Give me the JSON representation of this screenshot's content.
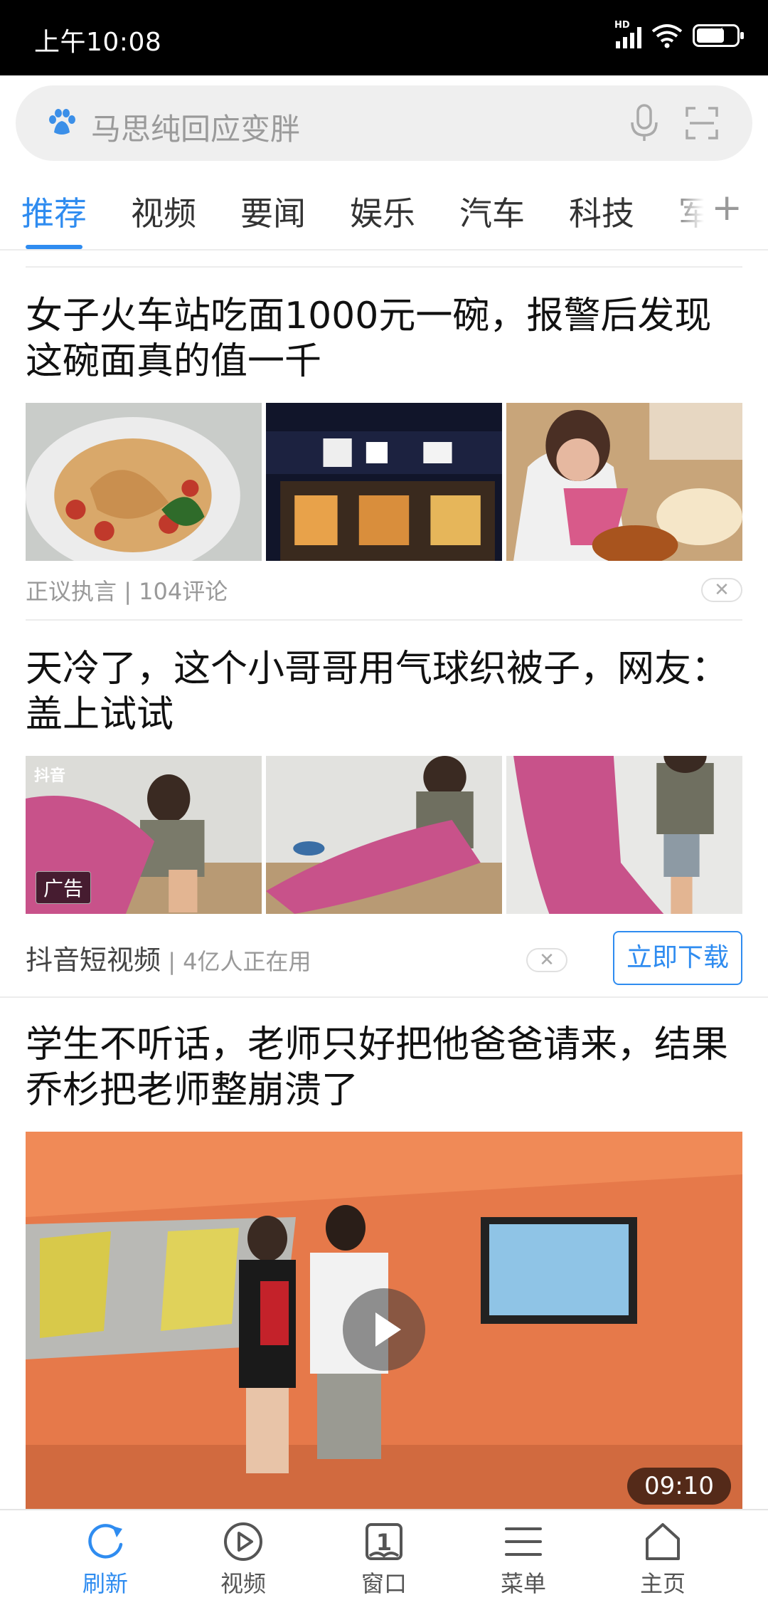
{
  "status_bar": {
    "time": "上午10:08",
    "signal_label": "HD",
    "battery_level": 0.7
  },
  "search": {
    "placeholder": "马思纯回应变胖"
  },
  "tabs": [
    {
      "label": "推荐",
      "active": true
    },
    {
      "label": "视频"
    },
    {
      "label": "要闻"
    },
    {
      "label": "娱乐"
    },
    {
      "label": "汽车"
    },
    {
      "label": "科技"
    },
    {
      "label": "军"
    }
  ],
  "feed": {
    "article1": {
      "title": "女子火车站吃面1000元一碗，报警后发现这碗面真的值一千",
      "source": "正议执言",
      "comments": "104评论"
    },
    "article2": {
      "title": "天冷了，这个小哥哥用气球织被子，网友：盖上试试",
      "ad_tag": "广告",
      "platform_logo": "抖音",
      "source": "抖音短视频",
      "users": "4亿人正在用",
      "cta": "立即下载"
    },
    "article3": {
      "title": "学生不听话，老师只好把他爸爸请来，结果乔杉把老师整崩溃了",
      "duration": "09:10"
    }
  },
  "bottom_nav": [
    {
      "label": "刷新",
      "icon": "refresh-icon",
      "active": true
    },
    {
      "label": "视频",
      "icon": "play-circle-icon"
    },
    {
      "label": "窗口",
      "icon": "window-icon",
      "badge": "1"
    },
    {
      "label": "菜单",
      "icon": "menu-icon"
    },
    {
      "label": "主页",
      "icon": "home-icon"
    }
  ],
  "colors": {
    "accent": "#2f8cf0",
    "status_bar": "#000000"
  }
}
